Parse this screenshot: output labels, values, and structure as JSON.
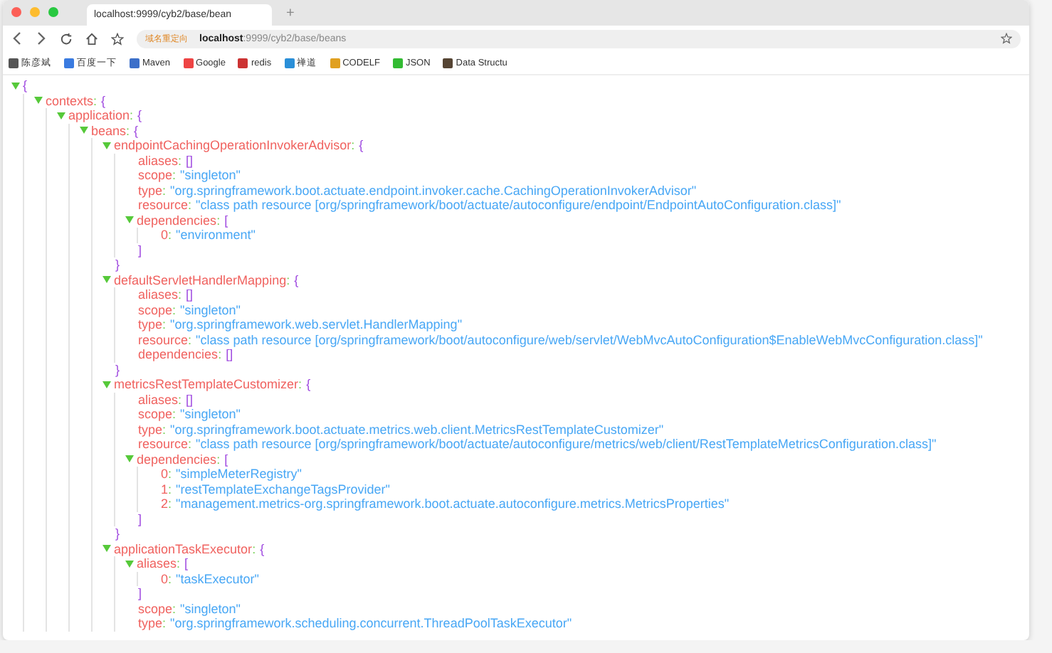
{
  "browser": {
    "tab": {
      "title": "localhost:9999/cyb2/base/bean"
    },
    "new_tab": "+",
    "address": {
      "badge": "域名重定向",
      "host": "localhost",
      "path": ":9999/cyb2/base/beans"
    },
    "bookmarks": [
      {
        "label": "陈彦斌"
      },
      {
        "label": "百度一下"
      },
      {
        "label": "Maven"
      },
      {
        "label": "Google"
      },
      {
        "label": "redis"
      },
      {
        "label": "禅道"
      },
      {
        "label": "CODELF"
      },
      {
        "label": "JSON"
      },
      {
        "label": "Data Structu"
      }
    ]
  },
  "tree": {
    "kind": "object",
    "open": "{",
    "expanded": true,
    "children": [
      {
        "kind": "object",
        "key": "contexts",
        "sep": ":",
        "open": "{",
        "expanded": true,
        "children": [
          {
            "kind": "object",
            "key": "application",
            "sep": ":",
            "open": "{",
            "expanded": true,
            "children": [
              {
                "kind": "object",
                "key": "beans",
                "sep": ":",
                "open": "{",
                "expanded": true,
                "children": [
                  {
                    "kind": "object",
                    "key": "endpointCachingOperationInvokerAdvisor",
                    "sep": ":",
                    "open": "{",
                    "close": "}",
                    "expanded": true,
                    "children": [
                      {
                        "kind": "empty",
                        "key": "aliases",
                        "sep": ":",
                        "value": "[]"
                      },
                      {
                        "kind": "string",
                        "key": "scope",
                        "sep": ":",
                        "value": "\"singleton\""
                      },
                      {
                        "kind": "string",
                        "key": "type",
                        "sep": ":",
                        "value": "\"org.springframework.boot.actuate.endpoint.invoker.cache.CachingOperationInvokerAdvisor\""
                      },
                      {
                        "kind": "string",
                        "key": "resource",
                        "sep": ":",
                        "value": "\"class path resource [org/springframework/boot/actuate/autoconfigure/endpoint/EndpointAutoConfiguration.class]\""
                      },
                      {
                        "kind": "array",
                        "key": "dependencies",
                        "sep": ":",
                        "open": "[",
                        "close": "]",
                        "expanded": true,
                        "children": [
                          {
                            "kind": "string",
                            "key": "0",
                            "sep": ":",
                            "value": "\"environment\""
                          }
                        ]
                      }
                    ]
                  },
                  {
                    "kind": "object",
                    "key": "defaultServletHandlerMapping",
                    "sep": ":",
                    "open": "{",
                    "close": "}",
                    "expanded": true,
                    "children": [
                      {
                        "kind": "empty",
                        "key": "aliases",
                        "sep": ":",
                        "value": "[]"
                      },
                      {
                        "kind": "string",
                        "key": "scope",
                        "sep": ":",
                        "value": "\"singleton\""
                      },
                      {
                        "kind": "string",
                        "key": "type",
                        "sep": ":",
                        "value": "\"org.springframework.web.servlet.HandlerMapping\""
                      },
                      {
                        "kind": "string",
                        "key": "resource",
                        "sep": ":",
                        "value": "\"class path resource [org/springframework/boot/autoconfigure/web/servlet/WebMvcAutoConfiguration$EnableWebMvcConfiguration.class]\""
                      },
                      {
                        "kind": "empty",
                        "key": "dependencies",
                        "sep": ":",
                        "value": "[]"
                      }
                    ]
                  },
                  {
                    "kind": "object",
                    "key": "metricsRestTemplateCustomizer",
                    "sep": ":",
                    "open": "{",
                    "close": "}",
                    "expanded": true,
                    "children": [
                      {
                        "kind": "empty",
                        "key": "aliases",
                        "sep": ":",
                        "value": "[]"
                      },
                      {
                        "kind": "string",
                        "key": "scope",
                        "sep": ":",
                        "value": "\"singleton\""
                      },
                      {
                        "kind": "string",
                        "key": "type",
                        "sep": ":",
                        "value": "\"org.springframework.boot.actuate.metrics.web.client.MetricsRestTemplateCustomizer\""
                      },
                      {
                        "kind": "string",
                        "key": "resource",
                        "sep": ":",
                        "value": "\"class path resource [org/springframework/boot/actuate/autoconfigure/metrics/web/client/RestTemplateMetricsConfiguration.class]\""
                      },
                      {
                        "kind": "array",
                        "key": "dependencies",
                        "sep": ":",
                        "open": "[",
                        "close": "]",
                        "expanded": true,
                        "children": [
                          {
                            "kind": "string",
                            "key": "0",
                            "sep": ":",
                            "value": "\"simpleMeterRegistry\""
                          },
                          {
                            "kind": "string",
                            "key": "1",
                            "sep": ":",
                            "value": "\"restTemplateExchangeTagsProvider\""
                          },
                          {
                            "kind": "string",
                            "key": "2",
                            "sep": ":",
                            "value": "\"management.metrics-org.springframework.boot.actuate.autoconfigure.metrics.MetricsProperties\""
                          }
                        ]
                      }
                    ]
                  },
                  {
                    "kind": "object",
                    "key": "applicationTaskExecutor",
                    "sep": ":",
                    "open": "{",
                    "expanded": true,
                    "children": [
                      {
                        "kind": "array",
                        "key": "aliases",
                        "sep": ":",
                        "open": "[",
                        "close": "]",
                        "expanded": true,
                        "children": [
                          {
                            "kind": "string",
                            "key": "0",
                            "sep": ":",
                            "value": "\"taskExecutor\""
                          }
                        ]
                      },
                      {
                        "kind": "string",
                        "key": "scope",
                        "sep": ":",
                        "value": "\"singleton\""
                      },
                      {
                        "kind": "string",
                        "key": "type",
                        "sep": ":",
                        "value": "\"org.springframework.scheduling.concurrent.ThreadPoolTaskExecutor\""
                      }
                    ]
                  }
                ]
              }
            ]
          }
        ]
      }
    ]
  }
}
